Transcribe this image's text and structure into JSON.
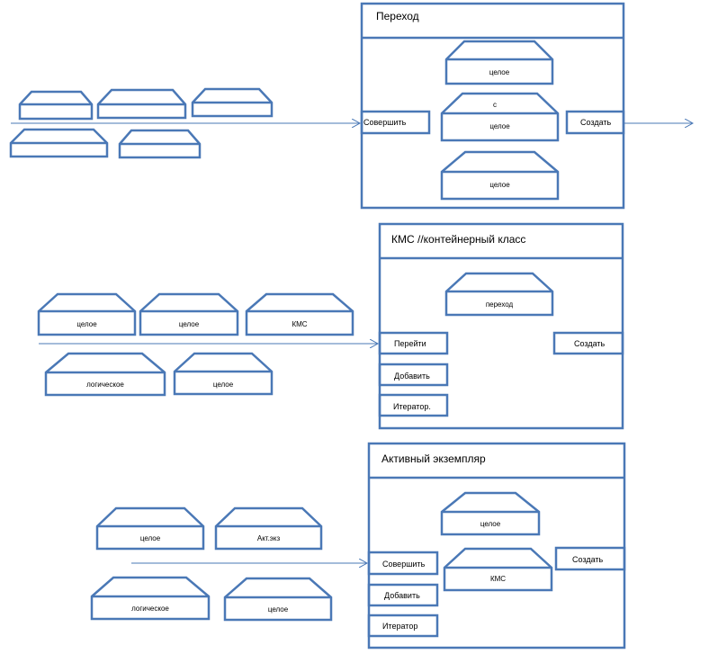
{
  "colors": {
    "stroke": "#4a78b6",
    "background": "#ffffff",
    "text": "#000000"
  },
  "class_perekhod": {
    "title": "Переход",
    "params": [
      "целое",
      "с",
      "целое",
      "целое"
    ],
    "methods": [
      "Совершить",
      "Создать"
    ]
  },
  "class_kms": {
    "title": "КМС //контейнерный класс",
    "params": [
      "переход"
    ],
    "methods": [
      "Перейти",
      "Создать",
      "Добавить",
      "Итератор."
    ],
    "inputs": [
      "целое",
      "целое",
      "КМС",
      "логическое",
      "целое"
    ]
  },
  "class_active": {
    "title": "Активный экземпляр",
    "params": [
      "целое",
      "КМС"
    ],
    "methods": [
      "Совершить",
      "Создать",
      "Добавить",
      "Итератор"
    ],
    "inputs": [
      "целое",
      "Акт.экз",
      "логическое",
      "целое"
    ]
  }
}
